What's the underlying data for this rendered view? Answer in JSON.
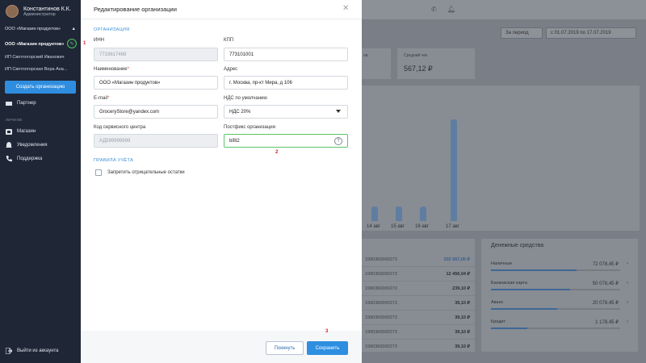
{
  "sidebar": {
    "user_name": "Константинов К.К.",
    "user_role": "Администратор",
    "org_header": "ООО «Магазин продуктов»",
    "orgs": [
      "ООО «Магазин продуктов»",
      "ИП Светлогорский Иванович",
      "ИП Светлогорская Вера Ана..."
    ],
    "create_org": "Создать организацию",
    "partner": "Партнер",
    "section_personal": "ЛИЧНОЕ",
    "menu": [
      "Магазин",
      "Уведомления",
      "Поддержка"
    ],
    "exit": "Выйти из аккаунта"
  },
  "dashboard": {
    "period": "За период",
    "range": "с 01.07.2019 по 17.07.2019",
    "kpi_left_label": "ов",
    "kpi_label": "Средний чек",
    "kpi_value": "567,12 ₽",
    "chart_labels": [
      "14 авг",
      "15 авг",
      "16 авг",
      "17 авг"
    ],
    "chart_values": [
      0.12,
      0.12,
      0.12,
      0.84
    ],
    "table_rows": [
      {
        "acc": "1990360000273",
        "amt": "332 567,00 ₽"
      },
      {
        "acc": "1990360000273",
        "amt": "12 456,04 ₽"
      },
      {
        "acc": "1990360000273",
        "amt": "239,10 ₽"
      },
      {
        "acc": "1990360000273",
        "amt": "39,10 ₽"
      },
      {
        "acc": "1990360000273",
        "amt": "39,10 ₽"
      },
      {
        "acc": "1990360000273",
        "amt": "39,10 ₽"
      },
      {
        "acc": "1990360000273",
        "amt": "39,10 ₽"
      }
    ],
    "money_title": "Денежные средства",
    "money_rows": [
      {
        "label": "Наличные",
        "value": "72 078,45 ₽",
        "fill": 0.66
      },
      {
        "label": "Банковская карта",
        "value": "50 078,45 ₽",
        "fill": 0.61
      },
      {
        "label": "Аванс",
        "value": "20 078,45 ₽",
        "fill": 0.51
      },
      {
        "label": "Кредит",
        "value": "1 178,45 ₽",
        "fill": 0.28
      }
    ]
  },
  "modal": {
    "title": "Редактирование организации",
    "section_org": "ОРГАНИЗАЦИЯ",
    "inn_label": "ИНН",
    "inn_value": "7719617469",
    "kpp_label": "КПП",
    "kpp_value": "773101001",
    "name_label": "Наименование",
    "name_value": "ООО «Магазин продуктов»",
    "address_label": "Адрес",
    "address_value": "г. Москва, пр-кт Мира, д 106",
    "email_label": "E-mail",
    "email_value": "GroceryStore@yandex.com",
    "vat_label": "НДС по умолчанию",
    "vat_value": "НДС 20%",
    "service_label": "Код сервисного центра",
    "service_value": "АД599999999",
    "postfix_label": "Постфикс организации",
    "postfix_value": "bifit2",
    "section_rules": "ПРАВИЛА УЧЁТА",
    "forbid_negative": "Запретить отрицательные остатки",
    "leave_button": "Покинуть",
    "save_button": "Сохранить",
    "required_mark": "*"
  },
  "markers": [
    "1",
    "2",
    "3"
  ]
}
